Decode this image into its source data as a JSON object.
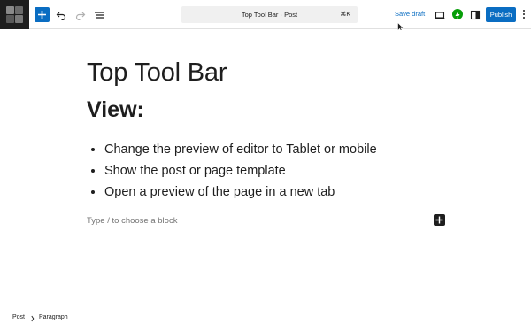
{
  "toolbar": {
    "inserter_icon": "plus-icon",
    "undo_icon": "undo-icon",
    "redo_icon": "redo-icon",
    "list_view_icon": "list-view-icon",
    "document_title": "Top Tool Bar · Post",
    "shortcut": "⌘K",
    "save_draft_label": "Save draft",
    "view_icon": "desktop-preview-icon",
    "jetpack_icon": "jetpack-icon",
    "settings_icon": "sidebar-settings-icon",
    "publish_label": "Publish",
    "more_icon": "more-vertical-icon",
    "accent_color": "#0a6dc2"
  },
  "editor": {
    "post_title": "Top Tool Bar",
    "heading_bold": "View",
    "heading_colon": ":",
    "list_items": [
      "Change the preview of editor to Tablet or mobile",
      "Show the post or page template",
      "Open a preview of the page in a new tab"
    ],
    "block_placeholder": "Type / to choose a block"
  },
  "footer": {
    "breadcrumb": [
      "Post",
      "Paragraph"
    ]
  }
}
